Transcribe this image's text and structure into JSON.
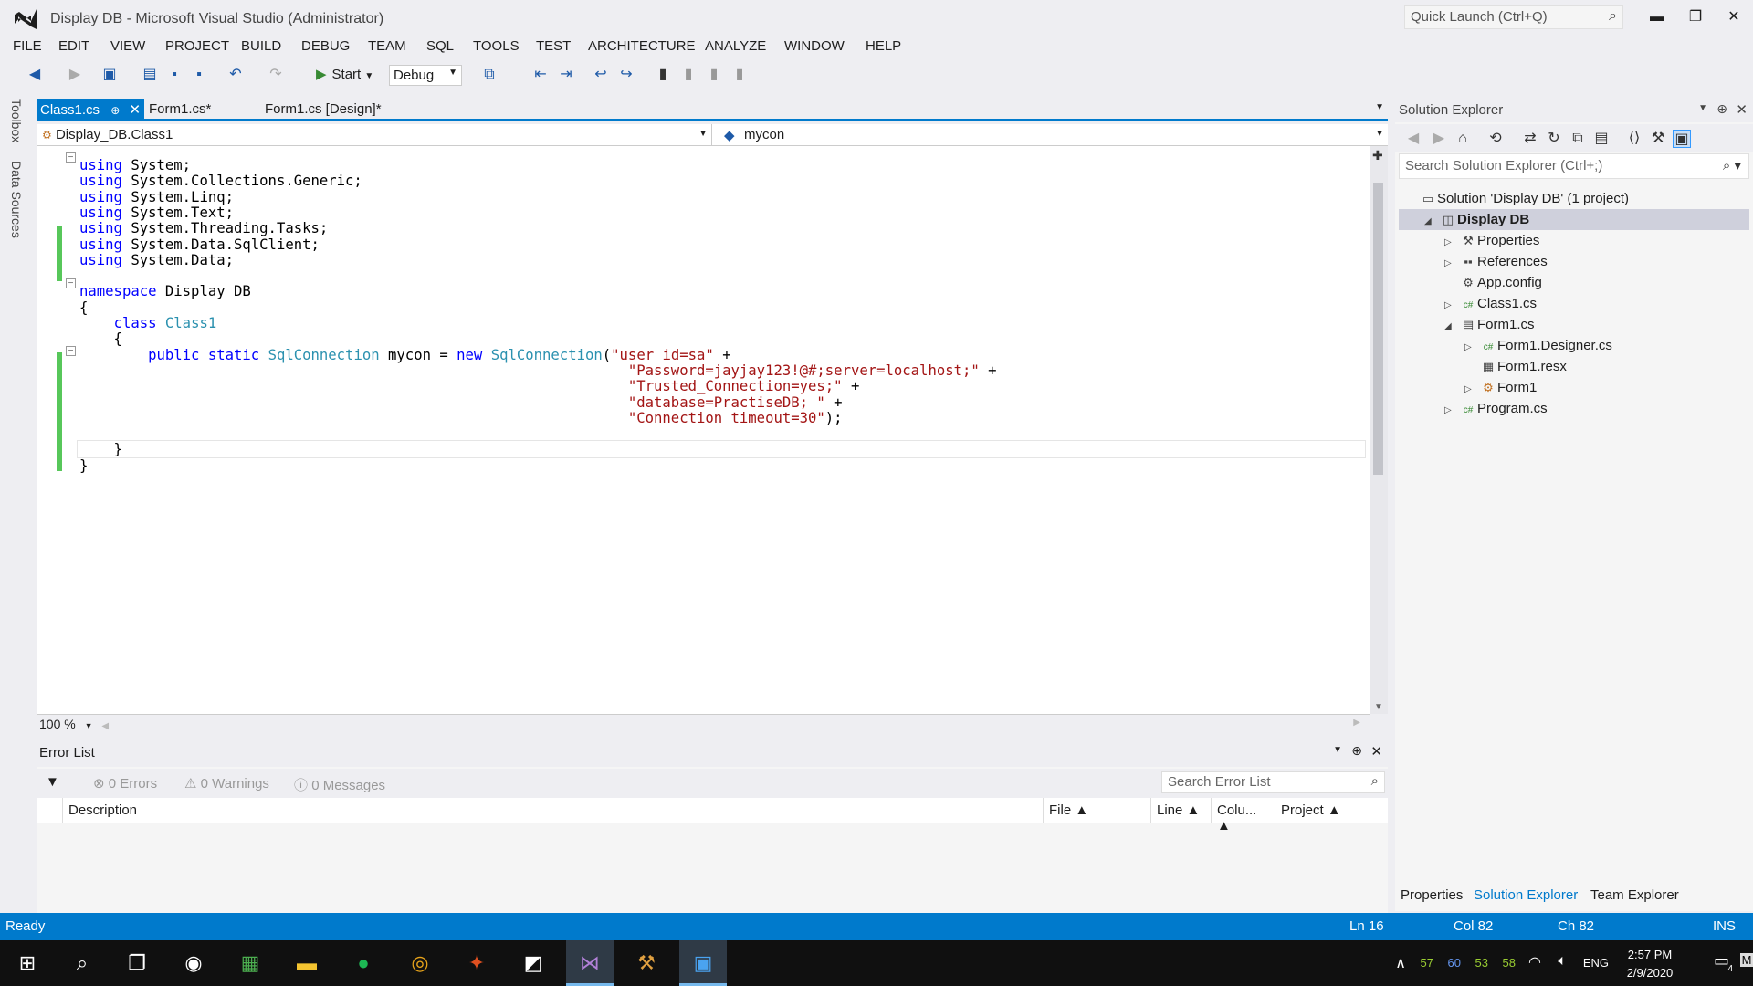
{
  "window": {
    "title": "Display DB - Microsoft Visual Studio (Administrator)",
    "quick_launch": "Quick Launch (Ctrl+Q)"
  },
  "menu": [
    "FILE",
    "EDIT",
    "VIEW",
    "PROJECT",
    "BUILD",
    "DEBUG",
    "TEAM",
    "SQL",
    "TOOLS",
    "TEST",
    "ARCHITECTURE",
    "ANALYZE",
    "WINDOW",
    "HELP"
  ],
  "toolbar": {
    "start_label": "Start",
    "config": "Debug"
  },
  "side_tabs": {
    "toolbox": "Toolbox",
    "data_sources": "Data Sources"
  },
  "doc_tabs": [
    {
      "label": "Class1.cs",
      "active": true
    },
    {
      "label": "Form1.cs*",
      "active": false
    },
    {
      "label": "Form1.cs [Design]*",
      "active": false
    }
  ],
  "navbar": {
    "type": "Display_DB.Class1",
    "member": "mycon"
  },
  "code": [
    "using System;",
    "using System.Collections.Generic;",
    "using System.Linq;",
    "using System.Text;",
    "using System.Threading.Tasks;",
    "using System.Data.SqlClient;",
    "using System.Data;",
    "",
    "namespace Display_DB",
    "{",
    "    class Class1",
    "    {",
    "        public static SqlConnection mycon = new SqlConnection(\"user id=sa\" +",
    "                                                                \"Password=jayjay123!@#;server=localhost;\" +",
    "                                                                \"Trusted_Connection=yes;\" +",
    "                                                                \"database=PractiseDB; \" +",
    "                                                                \"Connection timeout=30\");",
    "",
    "    }",
    "}"
  ],
  "zoom": "100 %",
  "error_list": {
    "title": "Error List",
    "errors": "0 Errors",
    "warnings": "0 Warnings",
    "messages": "0 Messages",
    "search_placeholder": "Search Error List",
    "columns": [
      "Description",
      "File",
      "Line",
      "Colu...",
      "Project"
    ]
  },
  "solution_explorer": {
    "title": "Solution Explorer",
    "search_placeholder": "Search Solution Explorer (Ctrl+;)",
    "tree": [
      {
        "label": "Solution 'Display DB' (1 project)",
        "level": 0,
        "arrow": "",
        "icon": "solution-icon",
        "selected": false
      },
      {
        "label": "Display DB",
        "level": 1,
        "arrow": "◢",
        "icon": "csproject-icon",
        "selected": true
      },
      {
        "label": "Properties",
        "level": 2,
        "arrow": "▷",
        "icon": "wrench-icon",
        "selected": false
      },
      {
        "label": "References",
        "level": 2,
        "arrow": "▷",
        "icon": "references-icon",
        "selected": false
      },
      {
        "label": "App.config",
        "level": 2,
        "arrow": "",
        "icon": "config-icon",
        "selected": false
      },
      {
        "label": "Class1.cs",
        "level": 2,
        "arrow": "▷",
        "icon": "csfile-icon",
        "selected": false
      },
      {
        "label": "Form1.cs",
        "level": 2,
        "arrow": "◢",
        "icon": "form-icon",
        "selected": false
      },
      {
        "label": "Form1.Designer.cs",
        "level": 3,
        "arrow": "▷",
        "icon": "csfile-icon",
        "selected": false
      },
      {
        "label": "Form1.resx",
        "level": 3,
        "arrow": "",
        "icon": "resx-icon",
        "selected": false
      },
      {
        "label": "Form1",
        "level": 3,
        "arrow": "▷",
        "icon": "form-class-icon",
        "selected": false
      },
      {
        "label": "Program.cs",
        "level": 2,
        "arrow": "▷",
        "icon": "csfile-icon",
        "selected": false
      }
    ],
    "bottom_tabs": [
      "Properties",
      "Solution Explorer",
      "Team Explorer"
    ]
  },
  "status": {
    "ready": "Ready",
    "ln": "Ln 16",
    "col": "Col 82",
    "ch": "Ch 82",
    "ins": "INS"
  },
  "taskbar": {
    "lang": "ENG",
    "time": "2:57 PM",
    "date": "2/9/2020",
    "notif_count": "4",
    "temps": [
      "57",
      "60",
      "53",
      "58"
    ],
    "trailing": "M"
  },
  "colors": {
    "accent": "#007acc",
    "keyword": "#0000ff",
    "type": "#2b91af",
    "string": "#a31515",
    "changes": "#57c75a"
  }
}
